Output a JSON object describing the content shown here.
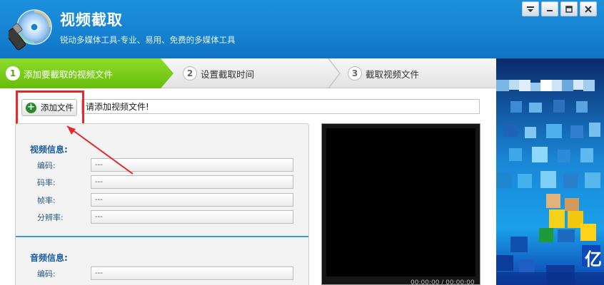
{
  "app": {
    "title": "视频截取",
    "subtitle": "锐动多媒体工具-专业、易用、免费的多媒体工具"
  },
  "window_controls": [
    "menu-icon",
    "minimize-icon",
    "maximize-icon",
    "close-icon"
  ],
  "steps": [
    {
      "num": "1",
      "label": "添加要截取的视频文件",
      "active": true
    },
    {
      "num": "2",
      "label": "设置截取时间",
      "active": false
    },
    {
      "num": "3",
      "label": "截取视频文件",
      "active": false
    }
  ],
  "add_file": {
    "button_label": "添加文件",
    "path_value": "请添加视频文件!"
  },
  "video_info": {
    "title": "视频信息:",
    "rows": [
      {
        "label": "编码:",
        "value": "---"
      },
      {
        "label": "码率:",
        "value": "---"
      },
      {
        "label": "帧率:",
        "value": "---"
      },
      {
        "label": "分辨率:",
        "value": "---"
      }
    ]
  },
  "audio_info": {
    "title": "音频信息:",
    "rows": [
      {
        "label": "编码:",
        "value": "---"
      }
    ]
  },
  "player": {
    "time": "00:00:00 / 00:00:00"
  },
  "ad_banner": {
    "text": "亿"
  },
  "colors": {
    "header": "#1683d2",
    "active_step": "#66bd0b",
    "annotation": "#e8272a",
    "section_title": "#1a5ea0"
  }
}
